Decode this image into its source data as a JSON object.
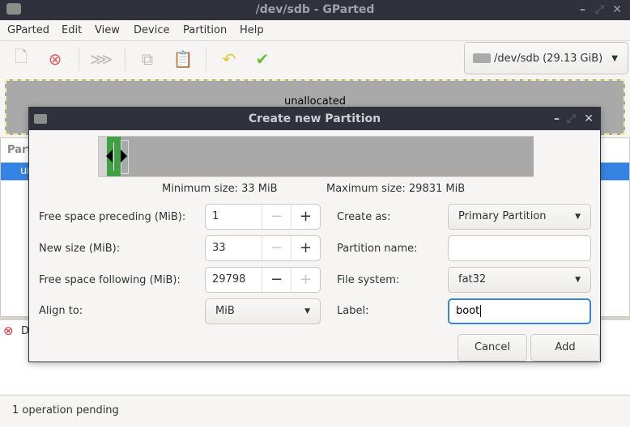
{
  "window": {
    "title": "/dev/sdb - GParted"
  },
  "menu": [
    "GParted",
    "Edit",
    "View",
    "Device",
    "Partition",
    "Help"
  ],
  "toolbar": {
    "device": "/dev/sdb (29.13 GiB)"
  },
  "diskmap": {
    "label": "unallocated"
  },
  "partition_list": {
    "header_visible": "Part",
    "row_visible": "un"
  },
  "log": {
    "item_visible": "D"
  },
  "status": "1 operation pending",
  "dialog": {
    "title": "Create new Partition",
    "min_size": "Minimum size: 33 MiB",
    "max_size": "Maximum size: 29831 MiB",
    "fields": {
      "preceding_label": "Free space preceding (MiB):",
      "preceding_value": "1",
      "newsize_label": "New size (MiB):",
      "newsize_value": "33",
      "following_label": "Free space following (MiB):",
      "following_value": "29798",
      "align_label": "Align to:",
      "align_value": "MiB",
      "create_as_label": "Create as:",
      "create_as_value": "Primary Partition",
      "name_label": "Partition name:",
      "name_value": "",
      "fs_label": "File system:",
      "fs_value": "fat32",
      "label_label": "Label:",
      "label_value": "boot"
    },
    "cancel": "Cancel",
    "add": "Add",
    "minus": "−",
    "plus": "+"
  },
  "colors": {
    "titlebar": "#2f323c",
    "selection": "#3584e4",
    "partition_fat32": "#3fa143",
    "unallocated": "#a9a9a9"
  }
}
